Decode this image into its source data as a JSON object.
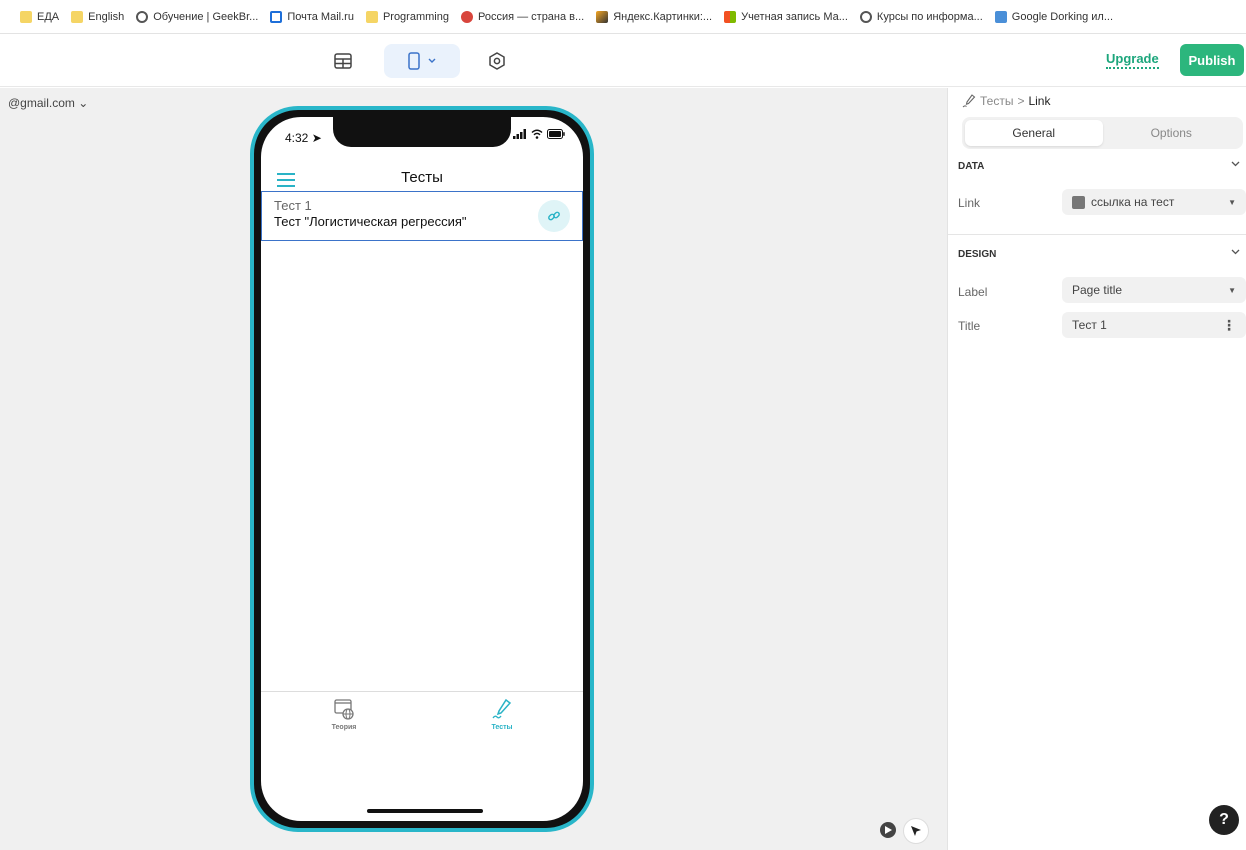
{
  "bookmarks": [
    {
      "label": "ЕДА",
      "icon": "folder-icon"
    },
    {
      "label": "English",
      "icon": "folder-icon"
    },
    {
      "label": "Обучение | GeekBr...",
      "icon": "geekbrains-icon"
    },
    {
      "label": "Почта Mail.ru",
      "icon": "mail-icon"
    },
    {
      "label": "Programming",
      "icon": "folder-icon"
    },
    {
      "label": "Россия — страна в...",
      "icon": "rcb-icon"
    },
    {
      "label": "Яндекс.Картинки:...",
      "icon": "yandex-images-icon"
    },
    {
      "label": "Учетная запись Ма...",
      "icon": "microsoft-icon"
    },
    {
      "label": "Курсы по информа...",
      "icon": "courses-icon"
    },
    {
      "label": "Google Dorking ил...",
      "icon": "google-dorking-icon"
    }
  ],
  "toolbar": {
    "upgrade_label": "Upgrade",
    "publish_label": "Publish"
  },
  "canvas": {
    "account": "@gmail.com ⌄"
  },
  "phone": {
    "time": "4:32",
    "app_title": "Тесты",
    "list": [
      {
        "subtitle": "Тест 1",
        "title": "Тест \"Логистическая регрессия\""
      }
    ],
    "tabs": [
      {
        "label": "Теория",
        "icon": "globe-window-icon",
        "active": false
      },
      {
        "label": "Тесты",
        "icon": "pen-icon",
        "active": true
      }
    ]
  },
  "panel": {
    "breadcrumb": {
      "parent": "Тесты",
      "separator": ">",
      "current": "Link"
    },
    "segments": {
      "general": "General",
      "options": "Options"
    },
    "data_section": {
      "heading": "DATA",
      "link_label": "Link",
      "link_value": "ссылка на тест"
    },
    "design_section": {
      "heading": "DESIGN",
      "label_label": "Label",
      "label_value": "Page title",
      "title_label": "Title",
      "title_value": "Тест 1"
    },
    "help": "?"
  },
  "colors": {
    "accent": "#2cb67d",
    "phone_frame": "#29b6c9",
    "selection": "#3b73c9"
  }
}
